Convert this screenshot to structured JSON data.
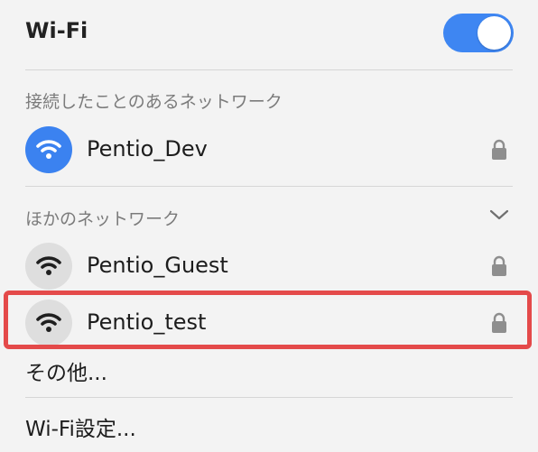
{
  "header": {
    "title": "Wi-Fi",
    "toggle_on": true
  },
  "known_section": {
    "header": "接続したことのあるネットワーク",
    "networks": [
      {
        "name": "Pentio_Dev",
        "secured": true,
        "connected": true,
        "icon": "wifi-icon"
      }
    ]
  },
  "other_section": {
    "header": "ほかのネットワーク",
    "expanded": true,
    "networks": [
      {
        "name": "Pentio_Guest",
        "secured": true,
        "connected": false,
        "icon": "wifi-icon"
      },
      {
        "name": "Pentio_test",
        "secured": true,
        "connected": false,
        "icon": "wifi-icon"
      }
    ],
    "other_label": "その他..."
  },
  "footer": {
    "settings_label": "Wi-Fi設定..."
  },
  "colors": {
    "accent": "#3e86f2",
    "highlight": "#e44a4a"
  }
}
